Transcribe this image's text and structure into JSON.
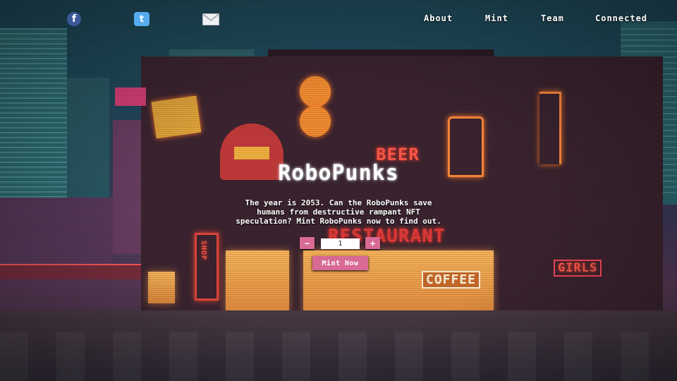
{
  "social": {
    "facebook_glyph": "f",
    "twitter_glyph": "t",
    "icons": [
      "facebook-icon",
      "twitter-icon",
      "mail-icon"
    ]
  },
  "nav": {
    "about": "About",
    "mint": "Mint",
    "team": "Team",
    "connected": "Connected"
  },
  "hero": {
    "title": "RoboPunks",
    "description": "The year is 2053. Can the RoboPunks save humans from destructive rampant NFT speculation? Mint RoboPunks now to find out."
  },
  "mint": {
    "decrement_label": "−",
    "increment_label": "+",
    "quantity": "1",
    "button_label": "Mint Now"
  },
  "scene_signs": {
    "beer": "BEER",
    "restaurant": "RESTAURANT",
    "coffee": "COFFEE",
    "girls": "GIRLS",
    "shop": "SHOP"
  },
  "colors": {
    "accent": "#d86a94",
    "facebook": "#3b5998",
    "twitter": "#55acee"
  }
}
